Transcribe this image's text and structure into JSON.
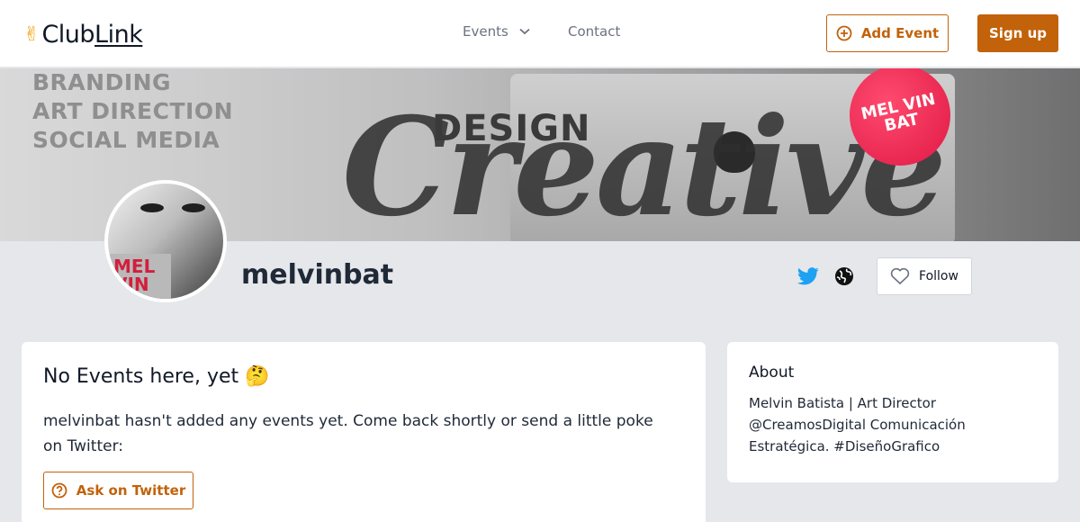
{
  "header": {
    "logo_text_club": "ClubLink",
    "nav_events": "Events",
    "nav_contact": "Contact",
    "add_event_label": "Add Event",
    "signup_label": "Sign up"
  },
  "banner": {
    "lines": [
      "BRANDING",
      "ART DIRECTION",
      "SOCIAL MEDIA"
    ],
    "design": "DESIGN",
    "creative": "Creative",
    "sticker": "MEL VIN BAT"
  },
  "profile": {
    "username": "melvinbat",
    "avatar_tag": "MEL VIN",
    "follow_label": "Follow"
  },
  "events_card": {
    "title": "No Events here, yet 🤔",
    "message": "melvinbat hasn't added any events yet. Come back shortly or send a little poke on Twitter:",
    "ask_label": "Ask on Twitter"
  },
  "about_card": {
    "title": "About",
    "text": "Melvin Batista | Art Director @CreamosDigital Comunicación Estratégica. #DiseñoGrafico"
  },
  "colors": {
    "accent": "#c2620a",
    "twitter": "#1da1f2",
    "background": "#e5e7eb"
  }
}
